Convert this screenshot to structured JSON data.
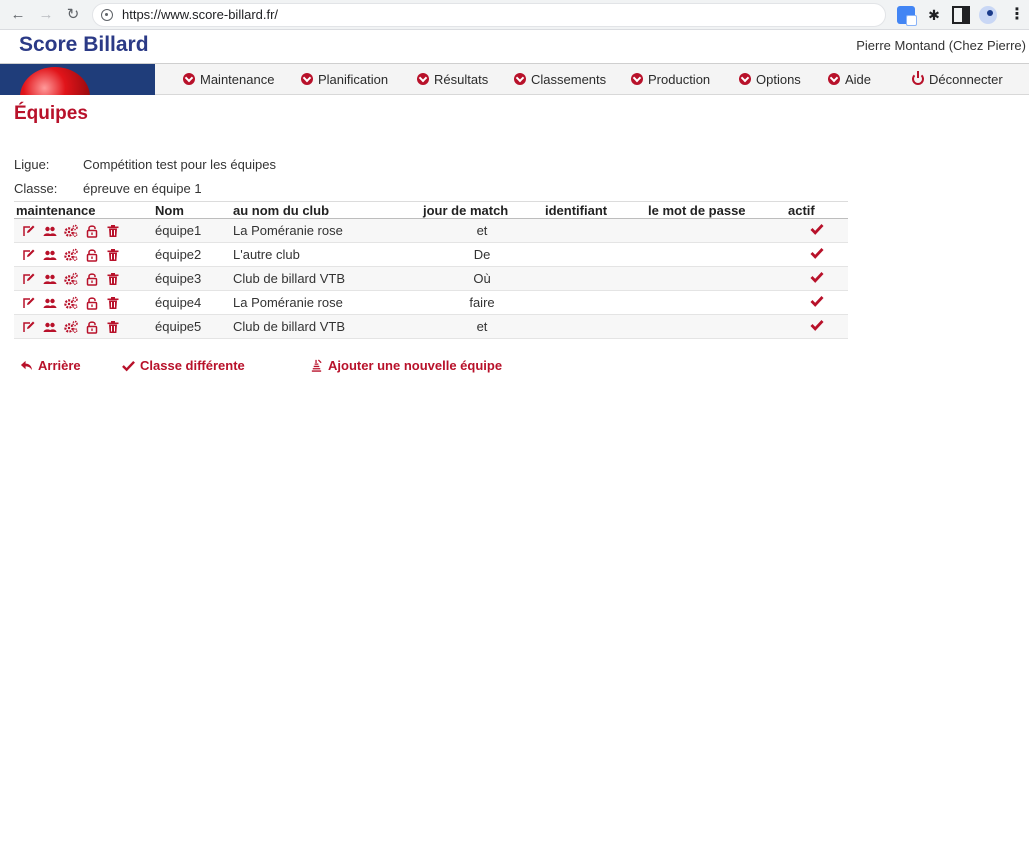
{
  "browser": {
    "url": "https://www.score-billard.fr/"
  },
  "header": {
    "site_title": "Score Billard",
    "user": "Pierre Montand (Chez Pierre)"
  },
  "menu": {
    "items": [
      {
        "label": "Maintenance",
        "icon": "chevron-circle-icon"
      },
      {
        "label": "Planification",
        "icon": "chevron-circle-icon"
      },
      {
        "label": "Résultats",
        "icon": "chevron-circle-icon"
      },
      {
        "label": "Classements",
        "icon": "chevron-circle-icon"
      },
      {
        "label": "Production",
        "icon": "chevron-circle-icon"
      },
      {
        "label": "Options",
        "icon": "chevron-circle-icon"
      },
      {
        "label": "Aide",
        "icon": "chevron-circle-icon"
      }
    ],
    "logout": "Déconnecter"
  },
  "page": {
    "title": "Équipes",
    "league_label": "Ligue:",
    "league_value": "Compétition test pour les équipes",
    "class_label": "Classe:",
    "class_value": "épreuve en équipe 1"
  },
  "table": {
    "headers": {
      "maintenance": "maintenance",
      "nom": "Nom",
      "club": "au nom du club",
      "jour": "jour de match",
      "identifiant": "identifiant",
      "mot_de_passe": "le mot de passe",
      "actif": "actif"
    },
    "rows": [
      {
        "nom": "équipe1",
        "club": "La Poméranie rose",
        "jour": "et",
        "identifiant": "",
        "mot_de_passe": "",
        "actif": true
      },
      {
        "nom": "équipe2",
        "club": "L'autre club",
        "jour": "De",
        "identifiant": "",
        "mot_de_passe": "",
        "actif": true
      },
      {
        "nom": "équipe3",
        "club": "Club de billard VTB",
        "jour": "Où",
        "identifiant": "",
        "mot_de_passe": "",
        "actif": true
      },
      {
        "nom": "équipe4",
        "club": "La Poméranie rose",
        "jour": "faire",
        "identifiant": "",
        "mot_de_passe": "",
        "actif": true
      },
      {
        "nom": "équipe5",
        "club": "Club de billard VTB",
        "jour": "et",
        "identifiant": "",
        "mot_de_passe": "",
        "actif": true
      }
    ]
  },
  "actions": {
    "back": "Arrière",
    "other_class": "Classe différente",
    "add_team": "Ajouter une nouvelle équipe"
  },
  "colors": {
    "accent": "#b8112a",
    "title_blue": "#2b3a86"
  }
}
